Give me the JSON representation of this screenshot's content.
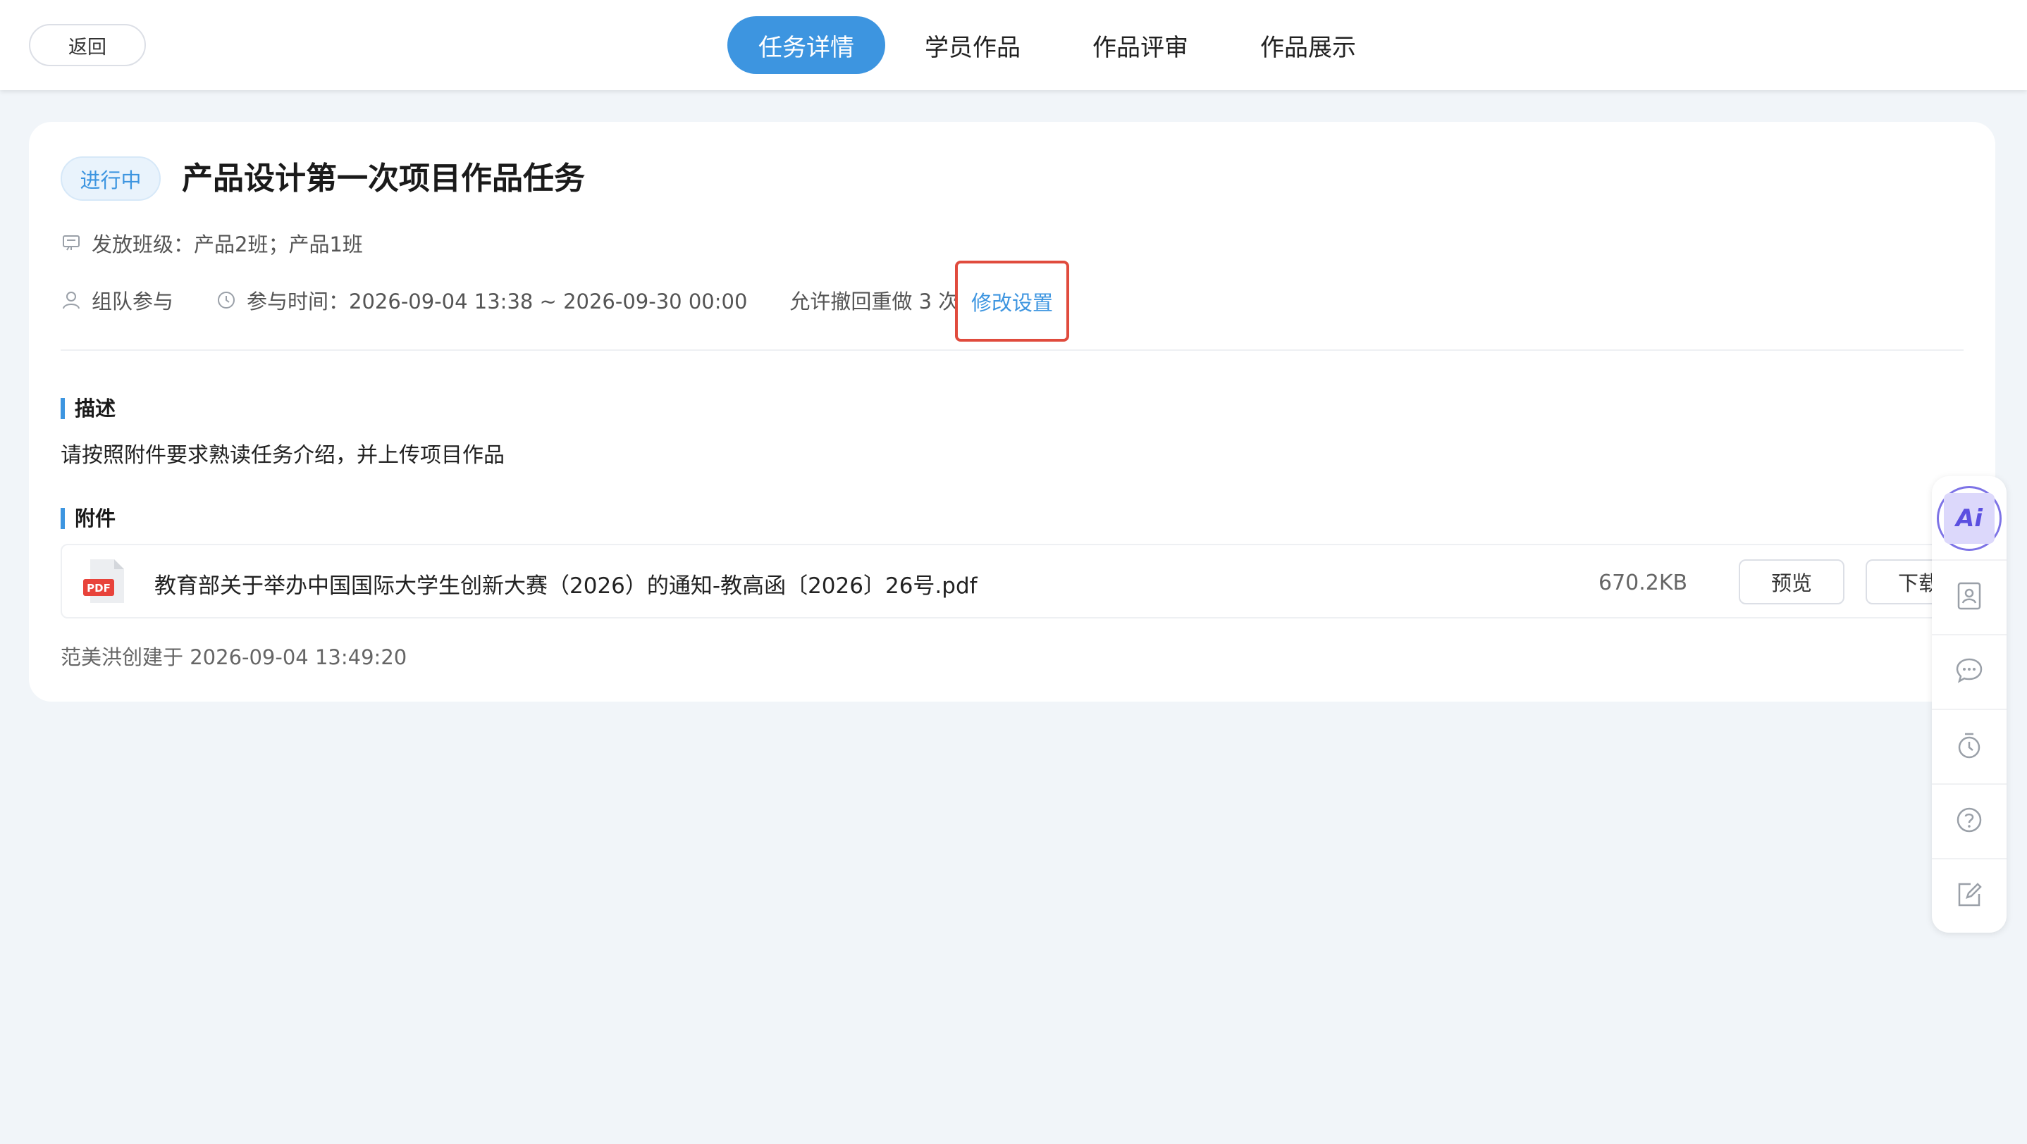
{
  "header": {
    "back_label": "返回",
    "tabs": [
      {
        "label": "任务详情",
        "active": true
      },
      {
        "label": "学员作品",
        "active": false
      },
      {
        "label": "作品评审",
        "active": false
      },
      {
        "label": "作品展示",
        "active": false
      }
    ]
  },
  "task": {
    "status": "进行中",
    "title": "产品设计第一次项目作品任务",
    "classes": "发放班级：产品2班；产品1班",
    "team": "组队参与",
    "time": "参与时间：2026-09-04 13:38 ~ 2026-09-30 00:00",
    "redo": "允许撤回重做 3 次",
    "edit_label": "修改设置"
  },
  "description": {
    "heading": "描述",
    "text": "请按照附件要求熟读任务介绍，并上传项目作品"
  },
  "attachments": {
    "heading": "附件",
    "items": [
      {
        "icon": "pdf-file-icon",
        "icon_label": "PDF",
        "name": "教育部关于举办中国国际大学生创新大赛（2026）的通知-教高函〔2026〕26号.pdf",
        "size": "670.2KB",
        "preview_label": "预览",
        "download_label": "下载"
      }
    ]
  },
  "footer": {
    "created": "范美洪创建于 2026-09-04 13:49:20"
  },
  "dock": {
    "ai_label": "Ai",
    "icons": [
      "ai-assistant-icon",
      "contact-card-icon",
      "chat-icon",
      "timer-icon",
      "help-icon",
      "edit-icon"
    ]
  },
  "colors": {
    "accent": "#3d95e0",
    "highlight_border": "#e04b3d",
    "ai_purple": "#7d73e6"
  }
}
